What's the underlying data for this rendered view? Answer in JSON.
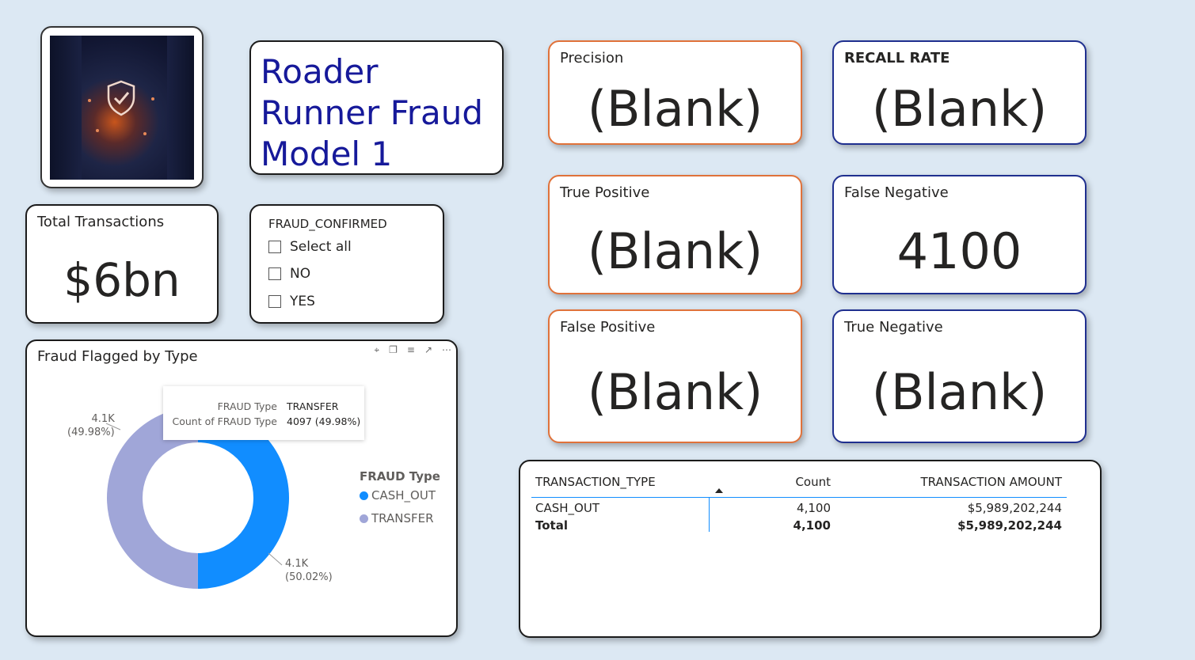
{
  "report": {
    "title": "Roader Runner Fraud Model 1"
  },
  "total_transactions": {
    "label": "Total Transactions",
    "value": "$6bn"
  },
  "slicer": {
    "field": "FRAUD_CONFIRMED",
    "options": [
      {
        "label": "Select all",
        "checked": false
      },
      {
        "label": "NO",
        "checked": false
      },
      {
        "label": "YES",
        "checked": false
      }
    ]
  },
  "kpis": {
    "precision": {
      "label": "Precision",
      "value": "(Blank)"
    },
    "recall": {
      "label": "RECALL RATE",
      "value": "(Blank)"
    },
    "true_positive": {
      "label": "True Positive",
      "value": "(Blank)"
    },
    "false_negative": {
      "label": "False Negative",
      "value": "4100"
    },
    "false_positive": {
      "label": "False Positive",
      "value": "(Blank)"
    },
    "true_negative": {
      "label": "True Negative",
      "value": "(Blank)"
    }
  },
  "chart_header_icons": [
    "pin-icon",
    "copy-icon",
    "filter-icon",
    "focus-mode-icon",
    "more-options-icon"
  ],
  "chart_data": {
    "type": "pie",
    "title": "Fraud Flagged by Type",
    "legend_title": "FRAUD Type",
    "legend_position": "right",
    "categories": [
      "CASH_OUT",
      "TRANSFER"
    ],
    "values": [
      4103,
      4097
    ],
    "data_labels": [
      {
        "value": "4.1K",
        "percent": "(50.02%)"
      },
      {
        "value": "4.1K",
        "percent": "(49.98%)"
      }
    ],
    "colors": [
      "#118dff",
      "#a0a6d8"
    ],
    "tooltip": {
      "rows": [
        {
          "key": "FRAUD Type",
          "value": "TRANSFER"
        },
        {
          "key": "Count of FRAUD Type",
          "value": "4097 (49.98%)"
        }
      ]
    }
  },
  "table": {
    "columns": [
      "TRANSACTION_TYPE",
      "Count",
      "TRANSACTION AMOUNT"
    ],
    "rows": [
      [
        "CASH_OUT",
        "4,100",
        "$5,989,202,244"
      ]
    ],
    "total": [
      "Total",
      "4,100",
      "$5,989,202,244"
    ]
  },
  "colors": {
    "background": "#dce8f3",
    "title_text": "#16199a",
    "accent_orange": "#e0723a",
    "accent_navy": "#1f2f8f"
  }
}
